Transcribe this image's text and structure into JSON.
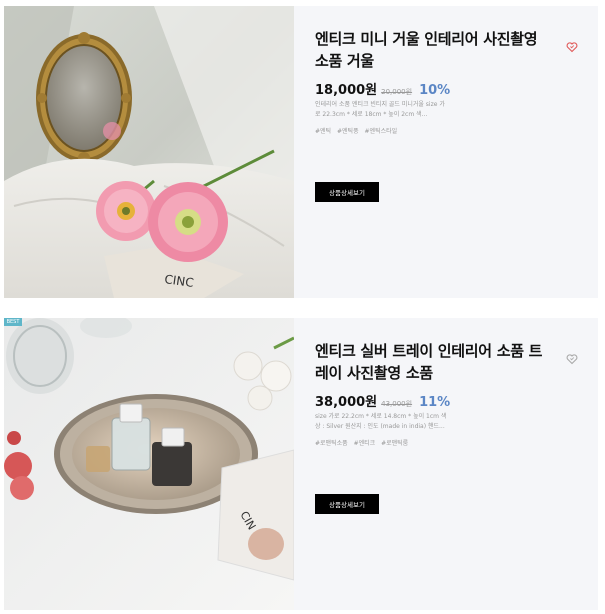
{
  "products": [
    {
      "title": "엔티크 미니 거울 인테리어 사진촬영 소품 거울",
      "price": "18,000원",
      "original_price": "20,000원",
      "discount": "10%",
      "description": "인테리어 소품 엔티크 빈티지 골드 미니거울 size 가로 22.3cm * 세로 18cm * 높이 2cm 색...",
      "tags": [
        "#엔틱",
        "#엔틱풍",
        "#엔틱스타일"
      ],
      "button_label": "상품상세보기",
      "badge": ""
    },
    {
      "title": "엔티크 실버 트레이 인테리어 소품 트레이 사진촬영 소품",
      "price": "38,000원",
      "original_price": "43,000원",
      "discount": "11%",
      "description": "size 가로 22.2cm * 세로 14.8cm * 높이 1cm 색상 : Silver 원산지 : 인도 (made in india) 핸드...",
      "tags": [
        "#로맨틱소품",
        "#엔티크",
        "#로맨틱룸"
      ],
      "button_label": "상품상세보기",
      "badge": "BEST"
    }
  ],
  "colors": {
    "discount": "#5b86c5",
    "button_bg": "#000000",
    "heart_filled": "#e05a5a",
    "heart_outline": "#aaaaaa"
  }
}
